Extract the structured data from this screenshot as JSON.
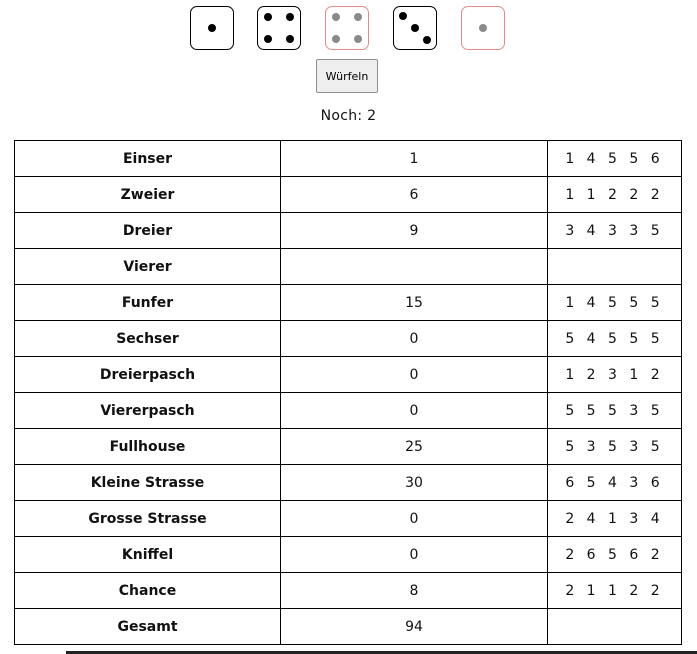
{
  "dice": [
    {
      "value": 1,
      "held": false,
      "icon": "die-face-1-icon"
    },
    {
      "value": 4,
      "held": false,
      "icon": "die-face-4-icon"
    },
    {
      "value": 4,
      "held": true,
      "icon": "die-face-4-icon"
    },
    {
      "value": 3,
      "held": false,
      "icon": "die-face-3-icon"
    },
    {
      "value": 1,
      "held": true,
      "icon": "die-face-1-icon"
    }
  ],
  "controls": {
    "roll_label": "Würfeln",
    "remaining_label": "Noch: 2"
  },
  "scoreboard": {
    "rows": [
      {
        "name": "Einser",
        "score": "1",
        "dice": "1 4 5 5 6"
      },
      {
        "name": "Zweier",
        "score": "6",
        "dice": "1 1 2 2 2"
      },
      {
        "name": "Dreier",
        "score": "9",
        "dice": "3 4 3 3 5"
      },
      {
        "name": "Vierer",
        "score": "",
        "dice": ""
      },
      {
        "name": "Funfer",
        "score": "15",
        "dice": "1 4 5 5 5"
      },
      {
        "name": "Sechser",
        "score": "0",
        "dice": "5 4 5 5 5"
      },
      {
        "name": "Dreierpasch",
        "score": "0",
        "dice": "1 2 3 1 2"
      },
      {
        "name": "Viererpasch",
        "score": "0",
        "dice": "5 5 5 3 5"
      },
      {
        "name": "Fullhouse",
        "score": "25",
        "dice": "5 3 5 3 5"
      },
      {
        "name": "Kleine Strasse",
        "score": "30",
        "dice": "6 5 4 3 6"
      },
      {
        "name": "Grosse Strasse",
        "score": "0",
        "dice": "2 4 1 3 4"
      },
      {
        "name": "Kniffel",
        "score": "0",
        "dice": "2 6 5 6 2"
      },
      {
        "name": "Chance",
        "score": "8",
        "dice": "2 1 1 2 2"
      },
      {
        "name": "Gesamt",
        "score": "94",
        "dice": ""
      }
    ]
  }
}
